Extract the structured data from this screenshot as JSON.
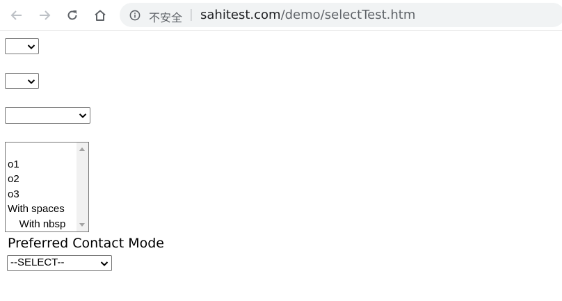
{
  "browser": {
    "security_label": "不安全",
    "separator": "|",
    "url_host": "sahitest.com",
    "url_path": "/demo/selectTest.htm"
  },
  "page": {
    "select1": {
      "value": ""
    },
    "select2": {
      "value": ""
    },
    "select3": {
      "value": ""
    },
    "listbox": {
      "options": [
        "",
        "o1",
        "o2",
        "o3",
        "With spaces",
        "    With nbsp"
      ]
    },
    "contact": {
      "label": "Preferred Contact Mode",
      "selected": "--SELECT--"
    }
  },
  "icons": {
    "back": "arrow-left-icon",
    "forward": "arrow-right-icon",
    "reload": "reload-icon",
    "home": "home-icon",
    "info": "info-icon",
    "dropdown": "chevron-down-icon"
  },
  "colors": {
    "toolbar_icon_disabled": "#bdc1c6",
    "toolbar_icon": "#5f6368",
    "omnibox_bg": "#f1f3f4",
    "border": "#767676"
  }
}
